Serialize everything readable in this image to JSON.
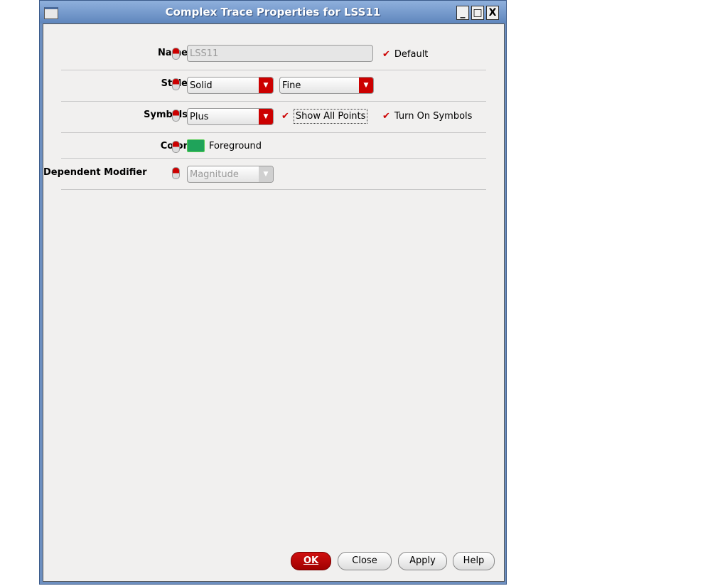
{
  "window": {
    "title": "Complex Trace Properties for LSS11"
  },
  "fields": {
    "name": {
      "label": "Name",
      "value": "LSS11",
      "default_label": "Default",
      "default_checked": true
    },
    "style": {
      "label": "Style",
      "line": "Solid",
      "width": "Fine"
    },
    "symbols": {
      "label": "Symbols",
      "value": "Plus",
      "show_all_points_label": "Show All Points",
      "show_all_points_checked": true,
      "turn_on_symbols_label": "Turn On Symbols",
      "turn_on_symbols_checked": true
    },
    "color": {
      "label": "Color",
      "value": "Foreground",
      "swatch": "#1fa35a"
    },
    "modifier": {
      "label": "Dependent Modifier",
      "value": "Magnitude"
    }
  },
  "buttons": {
    "ok": "OK",
    "close": "Close",
    "apply": "Apply",
    "help": "Help"
  }
}
